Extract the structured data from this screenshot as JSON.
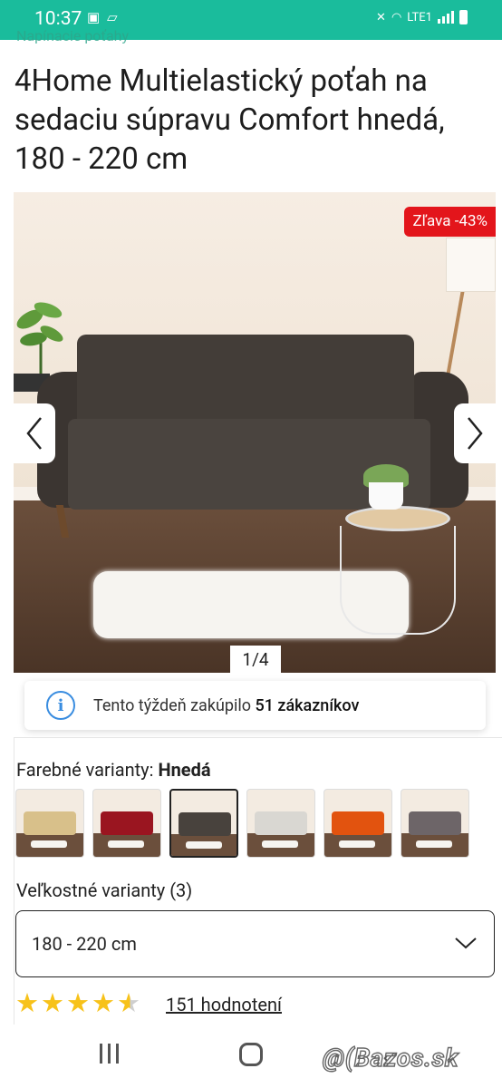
{
  "status_bar": {
    "time": "10:37",
    "network": "LTE1"
  },
  "breadcrumb": "Napínacie poťahy",
  "product": {
    "title": "4Home Multielastický poťah na sedaciu súpravu Comfort hnedá, 180 - 220 cm",
    "discount_badge": "Zľava -43%",
    "gallery_counter": "1/4"
  },
  "notice": {
    "prefix": "Tento týždeň zakúpilo",
    "highlight": "51 zákazníkov",
    "icon": "info-icon"
  },
  "color_variants": {
    "label": "Farebné varianty:",
    "selected": "Hnedá",
    "swatches": [
      {
        "name": "beige",
        "color": "#d8c08a"
      },
      {
        "name": "red",
        "color": "#9a1520"
      },
      {
        "name": "brown",
        "color": "#48423d",
        "active": true
      },
      {
        "name": "light-gray",
        "color": "#d9d7d2"
      },
      {
        "name": "orange",
        "color": "#e2530f"
      },
      {
        "name": "gray",
        "color": "#6d6568"
      }
    ]
  },
  "size_variants": {
    "label": "Veľkostné varianty (3)",
    "selected": "180 - 220 cm"
  },
  "rating": {
    "stars": 4.5,
    "reviews_label": "151 hodnotení"
  },
  "watermark": "@(Bazos.sk",
  "colors": {
    "status_bar": "#1abc9c",
    "badge": "#e3151b",
    "star": "#f7c21a",
    "info": "#3a8de0"
  }
}
